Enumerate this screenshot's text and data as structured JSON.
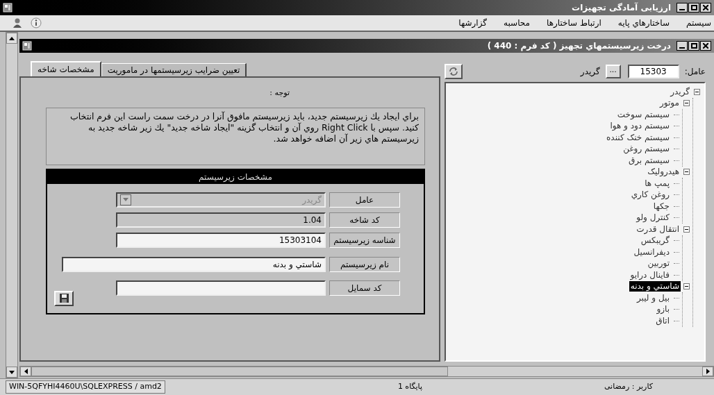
{
  "window": {
    "title": "ارزیابی آمادگی تجهیزات"
  },
  "menu": [
    {
      "label": "سیستم"
    },
    {
      "label": "ساختارهاي پایه"
    },
    {
      "label": "ارتباط ساختارها"
    },
    {
      "label": "محاسبه"
    },
    {
      "label": "گزارشها"
    }
  ],
  "child_window": {
    "title": "درخت زیرسیستمهاي تجهیز ( کد فرم : 440 )"
  },
  "filter": {
    "label": "عامل:",
    "value": "15303",
    "browse": "...",
    "name": "گریدر"
  },
  "tabs": [
    {
      "label": "تعیین ضرایب زیرسیستمها در ماموریت",
      "selected": false
    },
    {
      "label": "مشخصات شاخه",
      "selected": true
    }
  ],
  "note": {
    "title": "توجه :",
    "text": "براي ایجاد یك زیرسیستم جدید، باید زیرسیستم مافوق آنرا در درخت سمت راست این فرم انتخاب کنید. سپس با Right Click روي آن و انتخاب گزینه \"ایجاد شاخه جدید\" یك زیر شاخه جدید به زیرسیستم هاي زیر آن اضافه خواهد شد."
  },
  "section": {
    "title": "مشخصات زیرسیستم",
    "fields": [
      {
        "label": "عامل",
        "value": "گریدر",
        "kind": "dropdown",
        "disabled": true
      },
      {
        "label": "کد شاخه",
        "value": "1.04",
        "kind": "text",
        "disabled": true
      },
      {
        "label": "شناسه زیرسیستم",
        "value": "15303104",
        "kind": "text",
        "disabled": false
      },
      {
        "label": "نام زیرسیستم",
        "value": "شاستي و بدنه",
        "kind": "wide",
        "disabled": false
      },
      {
        "label": "کد سمایل",
        "kind": "text",
        "disabled": false
      }
    ]
  },
  "tree": [
    {
      "label": "گریدر",
      "selected": false,
      "children": [
        {
          "label": "موتور",
          "selected": false,
          "children": [
            {
              "label": "سیستم سوخت",
              "selected": false
            },
            {
              "label": "سیستم دود و هوا",
              "selected": false
            },
            {
              "label": "سیستم خنک کننده",
              "selected": false
            },
            {
              "label": "سیستم روغن",
              "selected": false
            },
            {
              "label": "سیستم برق",
              "selected": false
            }
          ]
        },
        {
          "label": "هیدرولیک",
          "selected": false,
          "children": [
            {
              "label": "پمپ ها",
              "selected": false
            },
            {
              "label": "روغن کاري",
              "selected": false
            },
            {
              "label": "جکها",
              "selected": false
            },
            {
              "label": "کنترل ولو",
              "selected": false
            }
          ]
        },
        {
          "label": "انتقال قدرت",
          "selected": false,
          "children": [
            {
              "label": "گریبکس",
              "selected": false
            },
            {
              "label": "دیفرانسیل",
              "selected": false
            },
            {
              "label": "توربین",
              "selected": false
            },
            {
              "label": "فاینال درایو",
              "selected": false
            }
          ]
        },
        {
          "label": "شاستي و بدنه",
          "selected": true,
          "children": [
            {
              "label": "بیل و لیبر",
              "selected": false
            },
            {
              "label": "بازو",
              "selected": false
            },
            {
              "label": "اتاق",
              "selected": false
            }
          ]
        }
      ]
    }
  ],
  "status_bar": {
    "connection": "WIN-5QFYHI4460U\\SQLEXPRESS / amd2",
    "position": "پایگاه 1",
    "user": "کاربر : رمضانی"
  }
}
